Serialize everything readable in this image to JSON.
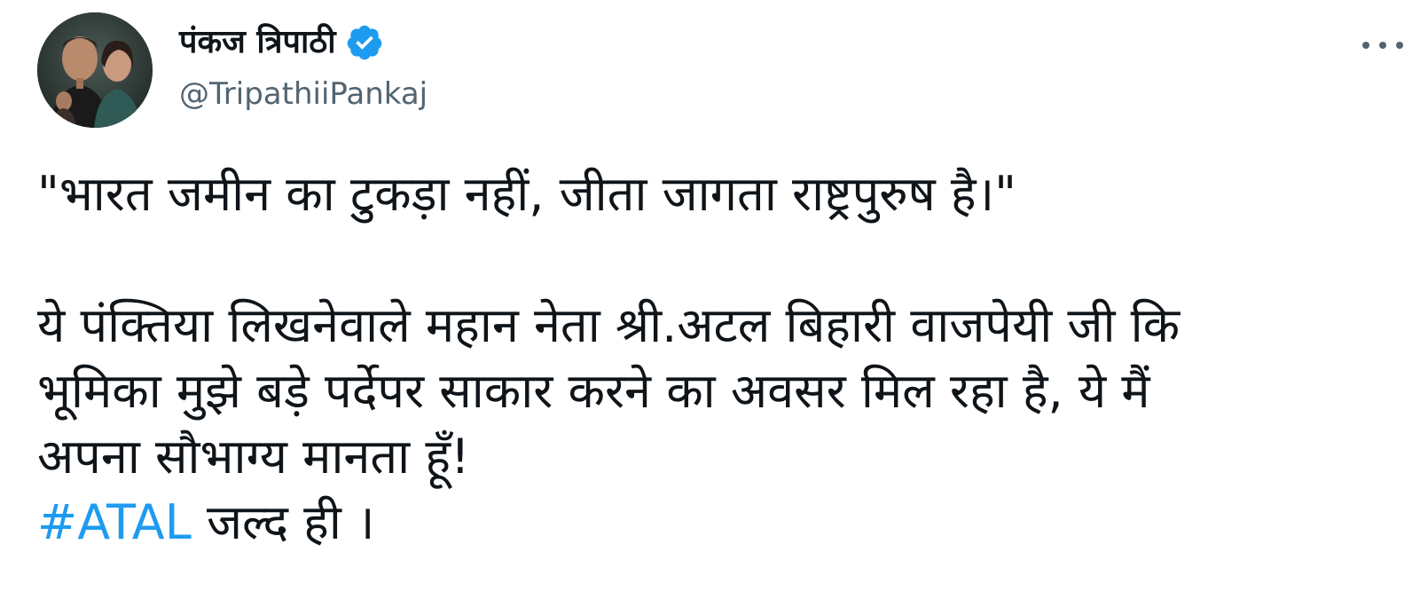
{
  "author": {
    "display_name": "पंकज त्रिपाठी",
    "handle": "@TripathiiPankaj",
    "verified": true,
    "verified_color": "#1d9bf0"
  },
  "menu": {
    "icon": "more-horizontal-icon"
  },
  "tweet": {
    "quote_line": "\"भारत जमीन का टुकड़ा नहीं, जीता जागता राष्ट्रपुरुष है।\"",
    "para_lines": [
      "ये पंक्तिया लिखनेवाले महान नेता श्री.अटल बिहारी वाजपेयी जी कि",
      "भूमिका मुझे बड़े पर्देपर साकार करने का अवसर मिल रहा है, ये मैं",
      "अपना सौभाग्य मानता हूँ!"
    ],
    "hashtag": "#ATAL",
    "hashtag_suffix": " जल्द ही ।",
    "link_color": "#1d9bf0"
  }
}
